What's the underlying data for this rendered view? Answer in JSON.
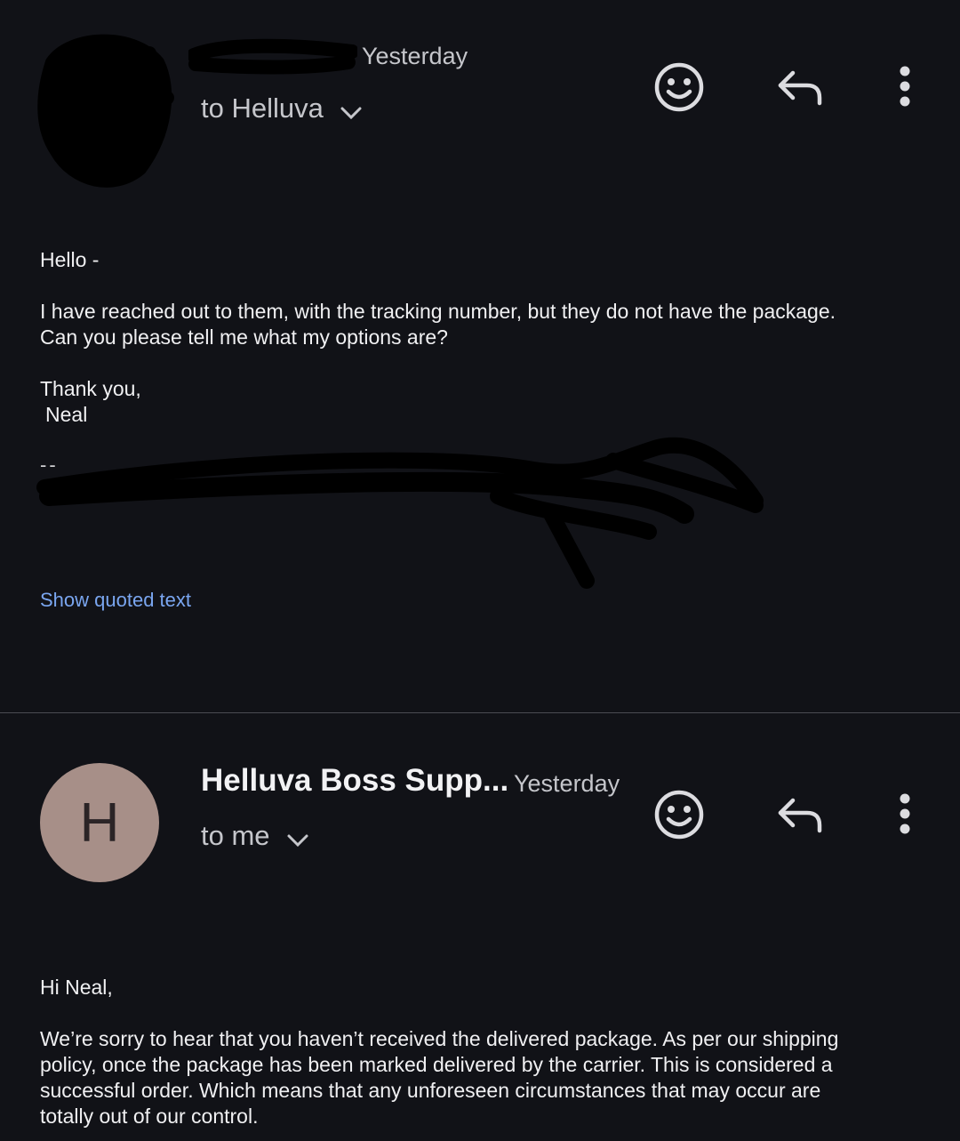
{
  "message1": {
    "time": "Yesterday",
    "recipients": "to Helluva",
    "greeting": "Hello -",
    "body_line1": "I have reached out to them, with the tracking number, but they do not have the package.",
    "body_line2": "Can you please tell me what my options are?",
    "closing": "Thank you,",
    "signature_name": "Neal",
    "signature_dash": "--",
    "show_quoted": "Show quoted text"
  },
  "message2": {
    "avatar_letter": "H",
    "avatar_color": "#a78f88",
    "sender": "Helluva Boss Supp...",
    "time": "Yesterday",
    "recipients": "to me",
    "greeting": "Hi Neal,",
    "body_line1": "We’re sorry to hear that you haven’t received the delivered package. As per our shipping",
    "body_line2": "policy, once the package has been marked delivered by the carrier. This is considered a",
    "body_line3": "successful order. Which means that any unforeseen circumstances that may occur are",
    "body_line4": "totally out of our control."
  },
  "icons": {
    "react": "smiley-icon",
    "reply": "reply-icon",
    "more": "more-vertical-icon",
    "expand": "chevron-down-icon"
  },
  "colors": {
    "background": "#111217",
    "link": "#7aa6f0",
    "divider": "#4a4b52"
  }
}
